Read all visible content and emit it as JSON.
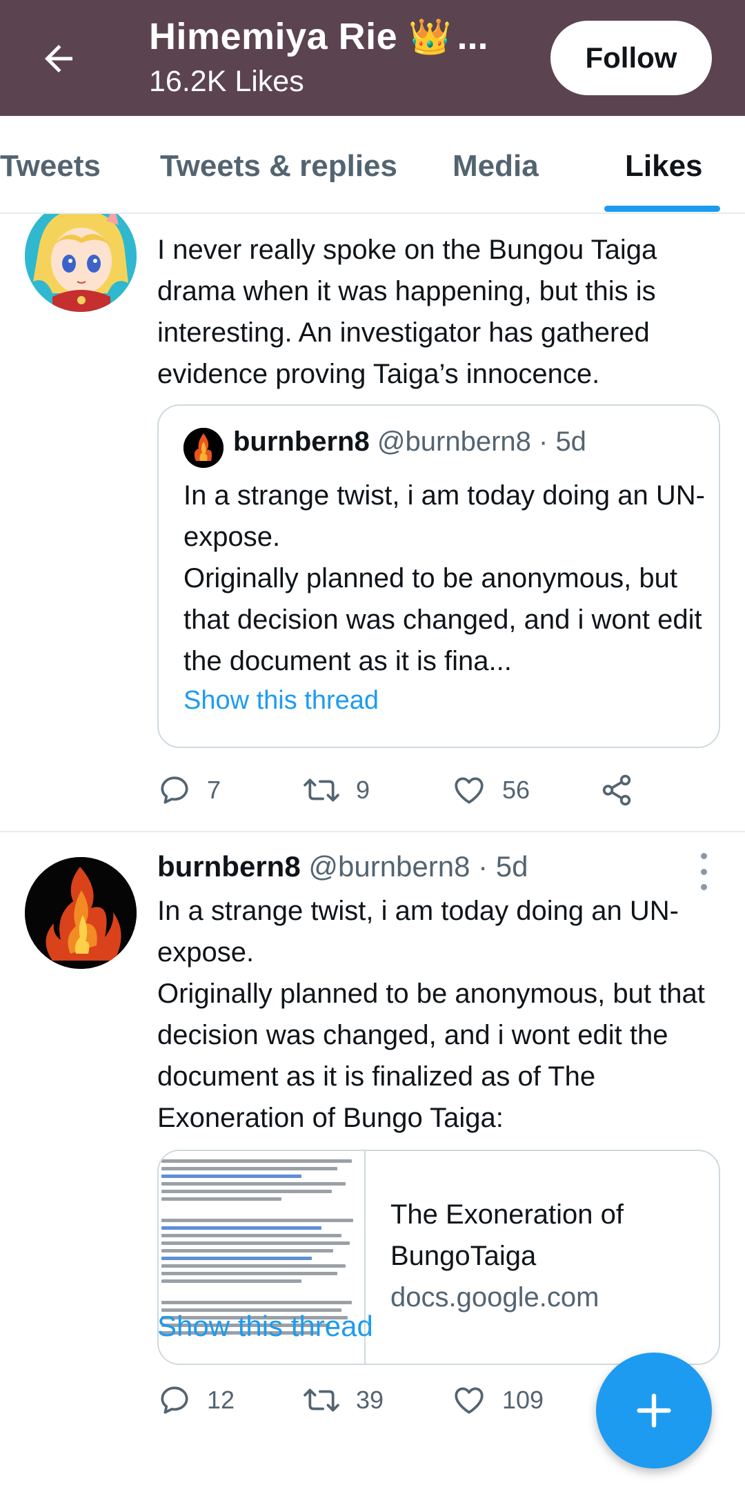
{
  "header": {
    "title": "Himemiya Rie",
    "title_emoji": "👑",
    "title_ellipsis": "...",
    "likes_count": "16.2K Likes",
    "follow_label": "Follow"
  },
  "tabs": [
    {
      "label": "Tweets"
    },
    {
      "label": "Tweets & replies"
    },
    {
      "label": "Media"
    },
    {
      "label": "Likes",
      "active": true
    }
  ],
  "tweet1": {
    "text": "I never really spoke on the Bungou Taiga drama when it was happening, but this is interesting. An investigator has gathered evidence proving Taiga’s innocence.",
    "quote": {
      "name": "burnbern8",
      "handle_time": "@burnbern8 · 5d",
      "text": "In a strange twist, i am today doing an UN-expose.\nOriginally planned to be anonymous, but that decision was changed, and i wont edit the document as it is fina...",
      "show_thread": "Show this thread"
    },
    "stats": {
      "replies": "7",
      "retweets": "9",
      "likes": "56"
    }
  },
  "tweet2": {
    "name": "burnbern8",
    "handle_time": "@burnbern8 · 5d",
    "text": "In a strange twist, i am today doing an UN-expose.\nOriginally planned to be anonymous, but that decision was changed, and i wont edit the document as it is finalized as of The Exoneration of Bungo Taiga:",
    "link_card": {
      "title": "The Exoneration of BungoTaiga",
      "domain": "docs.google.com"
    },
    "stats": {
      "replies": "12",
      "retweets": "39",
      "likes": "109"
    },
    "show_thread": "Show this thread"
  },
  "colors": {
    "header_bg": "#5b4350",
    "accent": "#1d9bf0",
    "muted_text": "#536471",
    "border": "#cfd9de"
  },
  "icons": [
    "back-arrow-icon",
    "reply-icon",
    "retweet-icon",
    "like-icon",
    "share-icon",
    "more-icon",
    "compose-plus-icon"
  ]
}
